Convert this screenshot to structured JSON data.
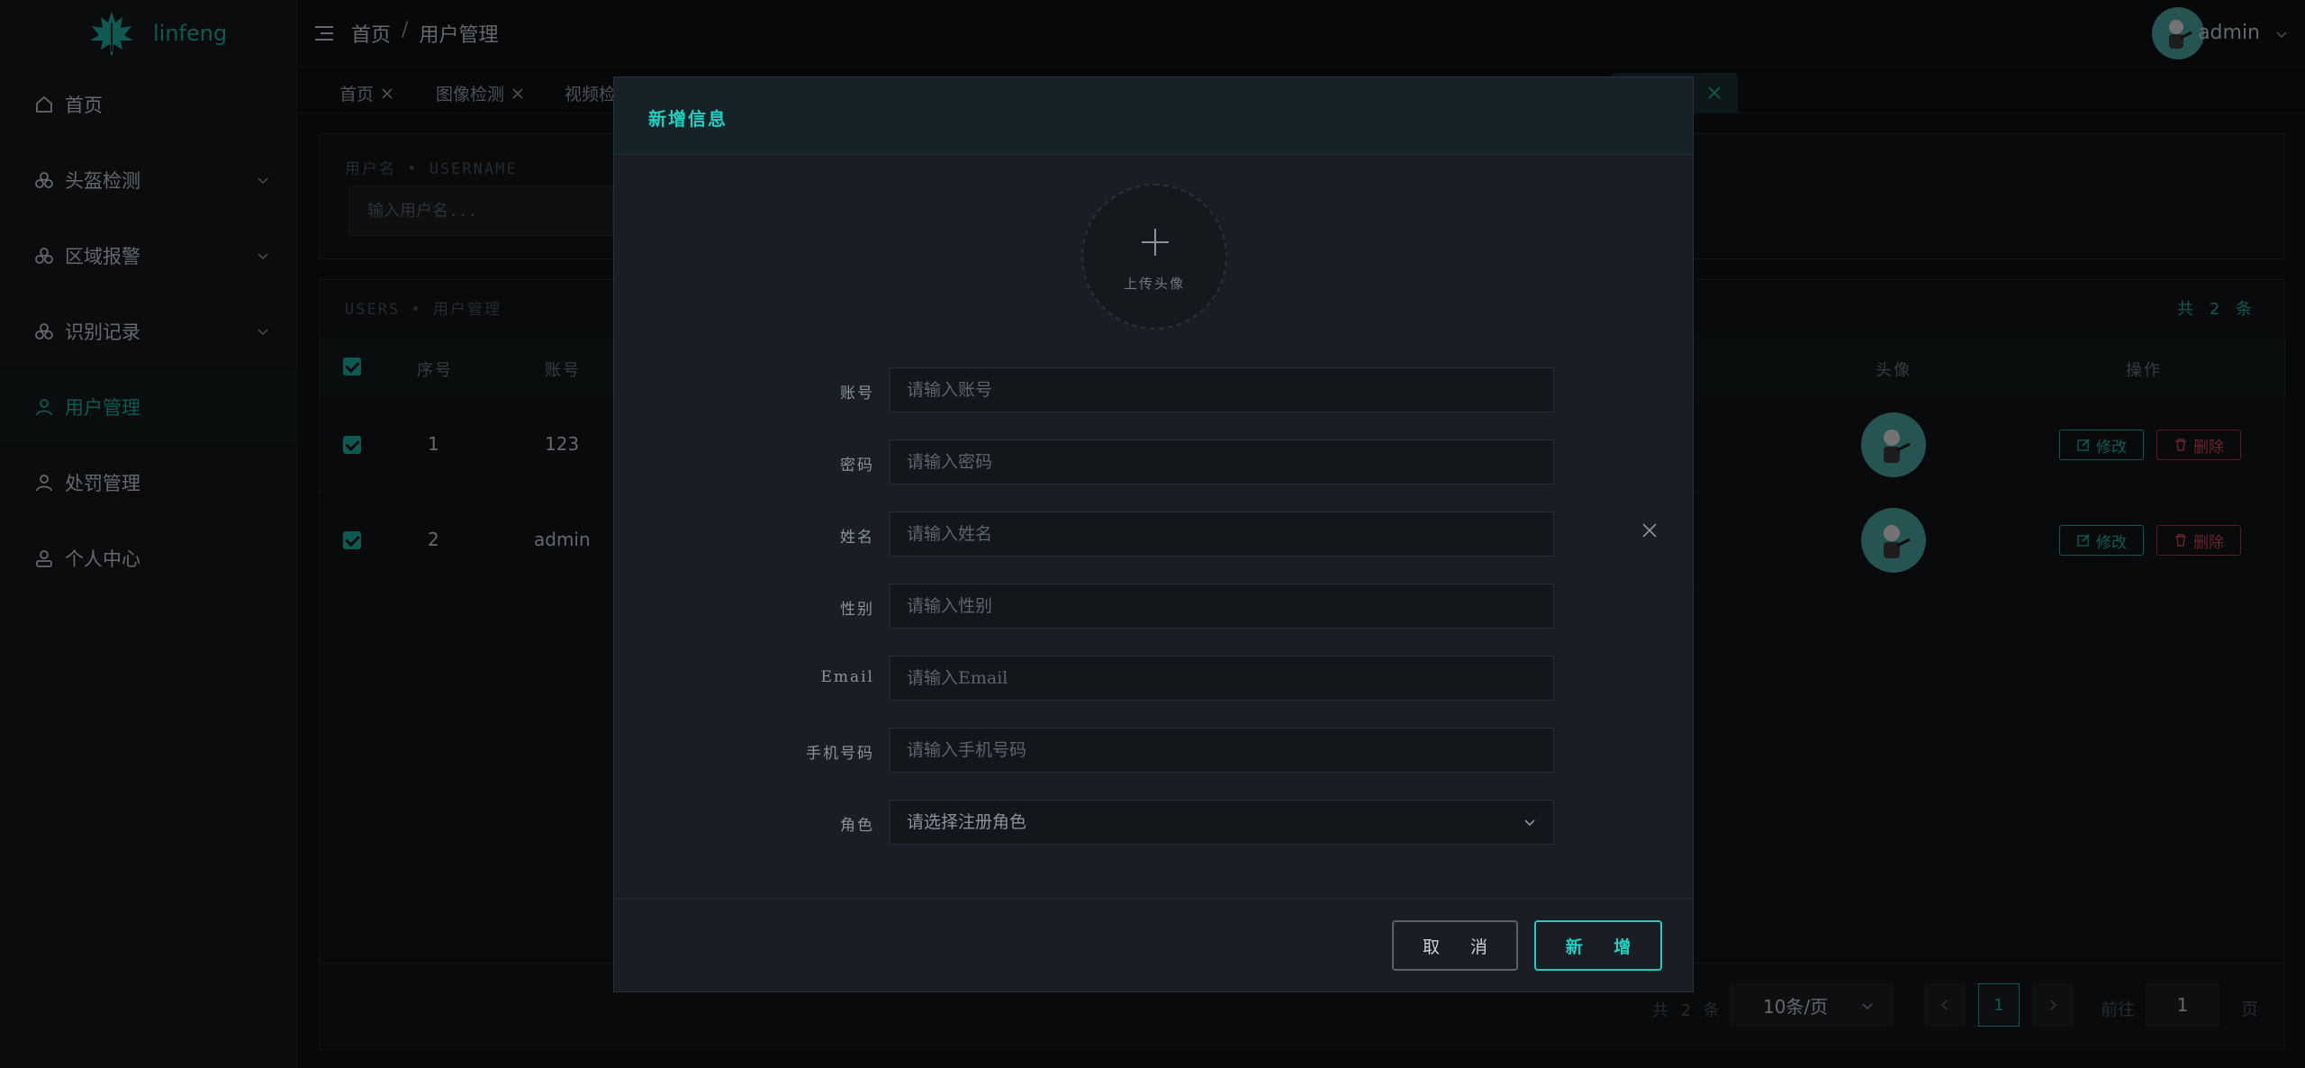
{
  "app": {
    "logo_text": "linfeng"
  },
  "sidebar": {
    "items": [
      {
        "label": "首页",
        "icon": "home-icon",
        "expandable": false,
        "active": false
      },
      {
        "label": "头盔检测",
        "icon": "dataset-icon",
        "expandable": true,
        "active": false
      },
      {
        "label": "区域报警",
        "icon": "dataset-icon",
        "expandable": true,
        "active": false
      },
      {
        "label": "识别记录",
        "icon": "dataset-icon",
        "expandable": true,
        "active": false
      },
      {
        "label": "用户管理",
        "icon": "user-icon",
        "expandable": false,
        "active": true
      },
      {
        "label": "处罚管理",
        "icon": "user-icon",
        "expandable": false,
        "active": false
      },
      {
        "label": "个人中心",
        "icon": "avatar-icon",
        "expandable": false,
        "active": false
      }
    ]
  },
  "header": {
    "breadcrumb": [
      "首页",
      "用户管理"
    ],
    "separator": "/",
    "username": "admin"
  },
  "tabs": [
    "首页",
    "图像检测",
    "视频检"
  ],
  "search": {
    "label": "用户名 • USERNAME",
    "placeholder": "输入用户名..."
  },
  "table": {
    "title": "USERS • 用户管理",
    "total_top": "共 2 条",
    "headers": {
      "index": "序号",
      "account": "账号",
      "avatar": "头像",
      "actions": "操作"
    },
    "rows": [
      {
        "index": "1",
        "account": "123"
      },
      {
        "index": "2",
        "account": "admin"
      }
    ],
    "edit_label": "修改",
    "delete_label": "删除"
  },
  "pagination": {
    "total": "共 2 条",
    "page_size": "10条/页",
    "current_page": "1",
    "goto_label": "前往",
    "goto_value": "1",
    "page_suffix": "页"
  },
  "modal": {
    "title": "新增信息",
    "upload_text": "上传头像",
    "fields": [
      {
        "label": "账号",
        "placeholder": "请输入账号"
      },
      {
        "label": "密码",
        "placeholder": "请输入密码"
      },
      {
        "label": "姓名",
        "placeholder": "请输入姓名"
      },
      {
        "label": "性别",
        "placeholder": "请输入性别"
      },
      {
        "label": "Email",
        "placeholder": "请输入Email"
      },
      {
        "label": "手机号码",
        "placeholder": "请输入手机号码"
      }
    ],
    "role": {
      "label": "角色",
      "placeholder": "请选择注册角色"
    },
    "cancel_label": "取 消",
    "submit_label": "新 增"
  },
  "colors": {
    "accent": "#1fb3a6",
    "danger": "#d2485f",
    "background": "#0f1113"
  }
}
